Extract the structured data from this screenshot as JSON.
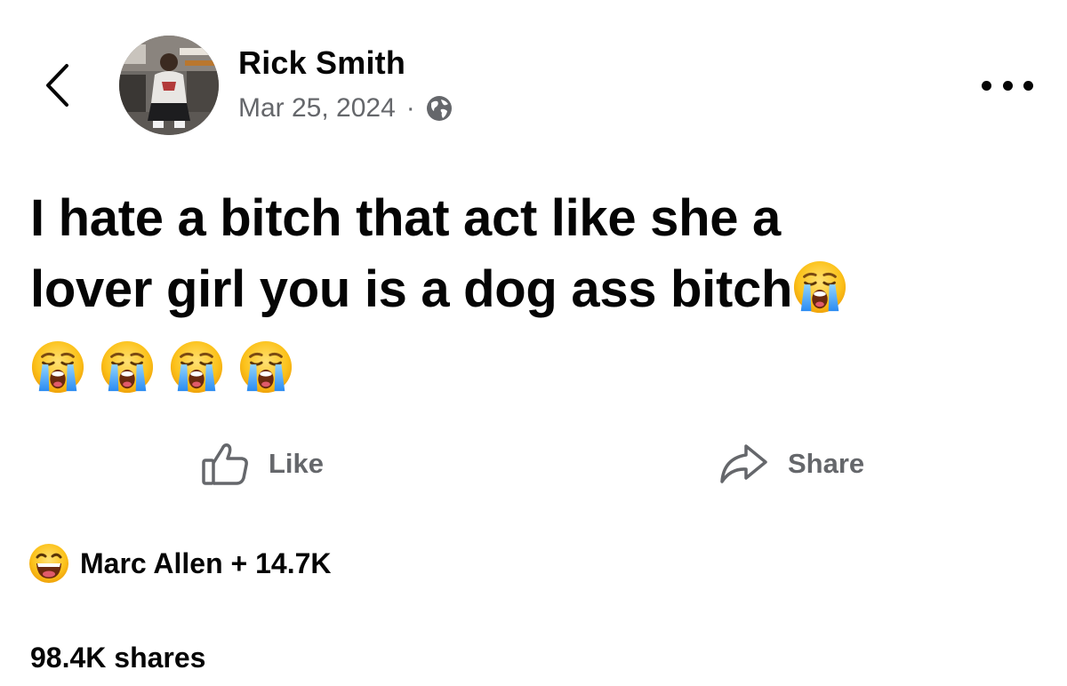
{
  "header": {
    "back_icon": "chevron-left-icon",
    "more_icon": "more-horizontal-icon"
  },
  "post": {
    "author": "Rick Smith",
    "date": "Mar 25, 2024",
    "separator": "·",
    "audience_icon": "globe-icon",
    "text_line_1": "I hate a bitch that act like she a",
    "text_line_2": "lover girl you is a dog ass bitch",
    "emoji": "😭",
    "emoji_icon": "loudly-crying-face-icon",
    "trailing_emoji_count": 4
  },
  "actions": {
    "like_label": "Like",
    "like_icon": "thumbs-up-icon",
    "share_label": "Share",
    "share_icon": "share-arrow-icon"
  },
  "reactions": {
    "icon": "haha-reaction-icon",
    "summary": "Marc Allen + 14.7K"
  },
  "shares": {
    "text": "98.4K shares"
  },
  "colors": {
    "text": "#050505",
    "secondary": "#65676b",
    "background": "#ffffff"
  }
}
